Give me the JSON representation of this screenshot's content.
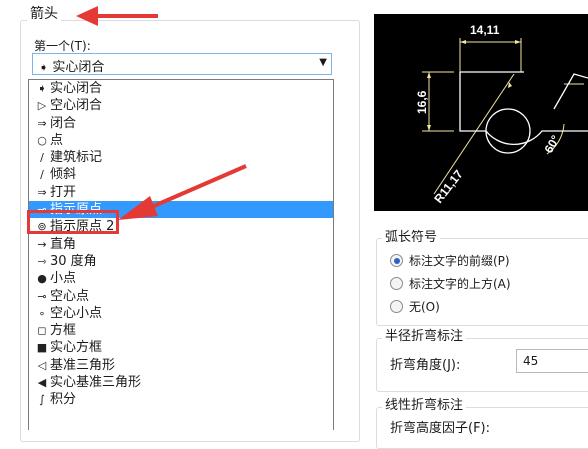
{
  "arrowheads": {
    "group_title": "箭头",
    "first_label": "第一个(T):",
    "first_selected": "实心闭合",
    "options": [
      {
        "icon": "filled-arrow-icon",
        "glyph": "➧",
        "label": "实心闭合"
      },
      {
        "icon": "open-arrow-icon",
        "glyph": "▷",
        "label": "空心闭合"
      },
      {
        "icon": "closed-arrow-icon",
        "glyph": "⇒",
        "label": "闭合"
      },
      {
        "icon": "dot-icon",
        "glyph": "○",
        "label": "点"
      },
      {
        "icon": "arch-tick-icon",
        "glyph": "∕",
        "label": "建筑标记"
      },
      {
        "icon": "oblique-icon",
        "glyph": "∕",
        "label": "倾斜"
      },
      {
        "icon": "open-icon",
        "glyph": "⇒",
        "label": "打开"
      },
      {
        "icon": "origin-indicator-icon",
        "glyph": "⊸",
        "label": "指示原点",
        "selected": true
      },
      {
        "icon": "origin-indicator-2-icon",
        "glyph": "⊚",
        "label": "指示原点 2"
      },
      {
        "icon": "right-angle-icon",
        "glyph": "→",
        "label": "直角"
      },
      {
        "icon": "angle-30-icon",
        "glyph": "⇾",
        "label": "30 度角"
      },
      {
        "icon": "small-dot-icon",
        "glyph": "●",
        "label": "小点"
      },
      {
        "icon": "dot-blank-icon",
        "glyph": "⊸",
        "label": "空心点"
      },
      {
        "icon": "dot-small-blank-icon",
        "glyph": "∘",
        "label": "空心小点"
      },
      {
        "icon": "box-icon",
        "glyph": "◻",
        "label": "方框"
      },
      {
        "icon": "box-filled-icon",
        "glyph": "■",
        "label": "实心方框"
      },
      {
        "icon": "datum-triangle-icon",
        "glyph": "◁",
        "label": "基准三角形"
      },
      {
        "icon": "datum-triangle-filled-icon",
        "glyph": "◀",
        "label": "实心基准三角形"
      },
      {
        "icon": "integral-icon",
        "glyph": "∫",
        "label": "积分"
      }
    ]
  },
  "preview": {
    "dim_top": "14,11",
    "dim_left": "16,6",
    "dim_angle": "60°",
    "dim_radius": "R11,17"
  },
  "arc_length": {
    "title": "弧长符号",
    "options": [
      {
        "label": "标注文字的前缀(P)",
        "checked": true
      },
      {
        "label": "标注文字的上方(A)",
        "checked": false
      },
      {
        "label": "无(O)",
        "checked": false
      }
    ]
  },
  "radius_jog": {
    "title": "半径折弯标注",
    "angle_label": "折弯角度(J):",
    "angle_value": "45"
  },
  "linear_jog": {
    "title": "线性折弯标注",
    "height_label": "折弯高度因子(F):"
  },
  "colors": {
    "accent": "#3399ff",
    "annotation_red": "#e53935",
    "preview_line": "#ffffff",
    "preview_dim": "#f2e6a0"
  }
}
